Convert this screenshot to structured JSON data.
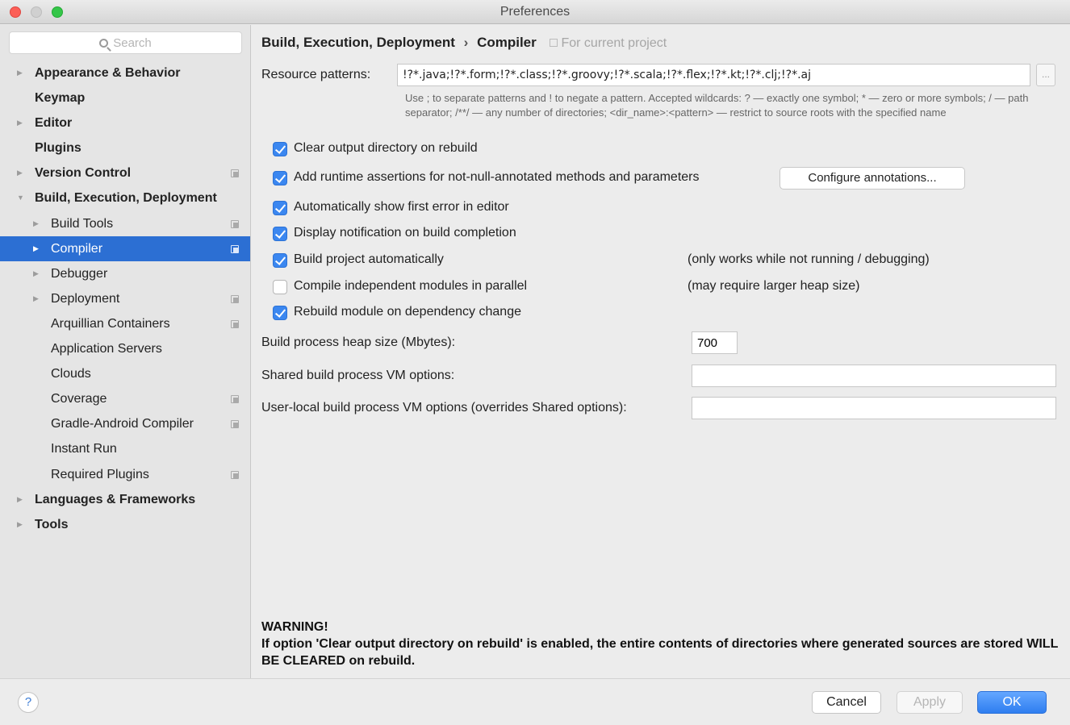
{
  "window": {
    "title": "Preferences"
  },
  "search": {
    "placeholder": "Search"
  },
  "sidebar": {
    "items": [
      {
        "label": "Appearance & Behavior",
        "level": 1,
        "bold": true,
        "arrow": "right",
        "copy": false,
        "selected": false
      },
      {
        "label": "Keymap",
        "level": 1,
        "bold": true,
        "arrow": "",
        "copy": false,
        "selected": false
      },
      {
        "label": "Editor",
        "level": 1,
        "bold": true,
        "arrow": "right",
        "copy": false,
        "selected": false
      },
      {
        "label": "Plugins",
        "level": 1,
        "bold": true,
        "arrow": "",
        "copy": false,
        "selected": false
      },
      {
        "label": "Version Control",
        "level": 1,
        "bold": true,
        "arrow": "right",
        "copy": true,
        "selected": false
      },
      {
        "label": "Build, Execution, Deployment",
        "level": 1,
        "bold": true,
        "arrow": "down",
        "copy": false,
        "selected": false
      },
      {
        "label": "Build Tools",
        "level": 2,
        "bold": false,
        "arrow": "right",
        "copy": true,
        "selected": false
      },
      {
        "label": "Compiler",
        "level": 2,
        "bold": false,
        "arrow": "right",
        "copy": true,
        "selected": true
      },
      {
        "label": "Debugger",
        "level": 2,
        "bold": false,
        "arrow": "right",
        "copy": false,
        "selected": false
      },
      {
        "label": "Deployment",
        "level": 2,
        "bold": false,
        "arrow": "right",
        "copy": true,
        "selected": false
      },
      {
        "label": "Arquillian Containers",
        "level": 2,
        "bold": false,
        "arrow": "",
        "copy": true,
        "selected": false
      },
      {
        "label": "Application Servers",
        "level": 2,
        "bold": false,
        "arrow": "",
        "copy": false,
        "selected": false
      },
      {
        "label": "Clouds",
        "level": 2,
        "bold": false,
        "arrow": "",
        "copy": false,
        "selected": false
      },
      {
        "label": "Coverage",
        "level": 2,
        "bold": false,
        "arrow": "",
        "copy": true,
        "selected": false
      },
      {
        "label": "Gradle-Android Compiler",
        "level": 2,
        "bold": false,
        "arrow": "",
        "copy": true,
        "selected": false
      },
      {
        "label": "Instant Run",
        "level": 2,
        "bold": false,
        "arrow": "",
        "copy": false,
        "selected": false
      },
      {
        "label": "Required Plugins",
        "level": 2,
        "bold": false,
        "arrow": "",
        "copy": true,
        "selected": false
      },
      {
        "label": "Languages & Frameworks",
        "level": 1,
        "bold": true,
        "arrow": "right",
        "copy": false,
        "selected": false
      },
      {
        "label": "Tools",
        "level": 1,
        "bold": true,
        "arrow": "right",
        "copy": false,
        "selected": false
      }
    ]
  },
  "breadcrumb": {
    "parent": "Build, Execution, Deployment",
    "separator": "›",
    "current": "Compiler",
    "scope": "For current project"
  },
  "resource": {
    "label": "Resource patterns:",
    "value": "!?*.java;!?*.form;!?*.class;!?*.groovy;!?*.scala;!?*.flex;!?*.kt;!?*.clj;!?*.aj",
    "browse_label": "...",
    "hint": "Use ; to separate patterns and ! to negate a pattern. Accepted wildcards: ? — exactly one symbol; * — zero or more symbols; / — path separator; /**/ — any number of directories; <dir_name>:<pattern> — restrict to source roots with the specified name"
  },
  "options": [
    {
      "label": "Clear output directory on rebuild",
      "checked": true,
      "note": ""
    },
    {
      "label": "Add runtime assertions for not-null-annotated methods and parameters",
      "checked": true,
      "note": ""
    },
    {
      "label": "Automatically show first error in editor",
      "checked": true,
      "note": ""
    },
    {
      "label": "Display notification on build completion",
      "checked": true,
      "note": ""
    },
    {
      "label": "Build project automatically",
      "checked": true,
      "note": "(only works while not running / debugging)"
    },
    {
      "label": "Compile independent modules in parallel",
      "checked": false,
      "note": "(may require larger heap size)"
    },
    {
      "label": "Rebuild module on dependency change",
      "checked": true,
      "note": ""
    }
  ],
  "configure_annotations_label": "Configure annotations...",
  "heap": {
    "label": "Build process heap size (Mbytes):",
    "value": "700"
  },
  "shared_vm": {
    "label": "Shared build process VM options:",
    "value": ""
  },
  "user_vm": {
    "label": "User-local build process VM options (overrides Shared options):",
    "value": ""
  },
  "warning": {
    "title": "WARNING!",
    "text": "If option 'Clear output directory on rebuild' is enabled, the entire contents of directories where generated sources are stored WILL BE CLEARED on rebuild."
  },
  "footer": {
    "help_label": "?",
    "cancel_label": "Cancel",
    "apply_label": "Apply",
    "ok_label": "OK"
  }
}
